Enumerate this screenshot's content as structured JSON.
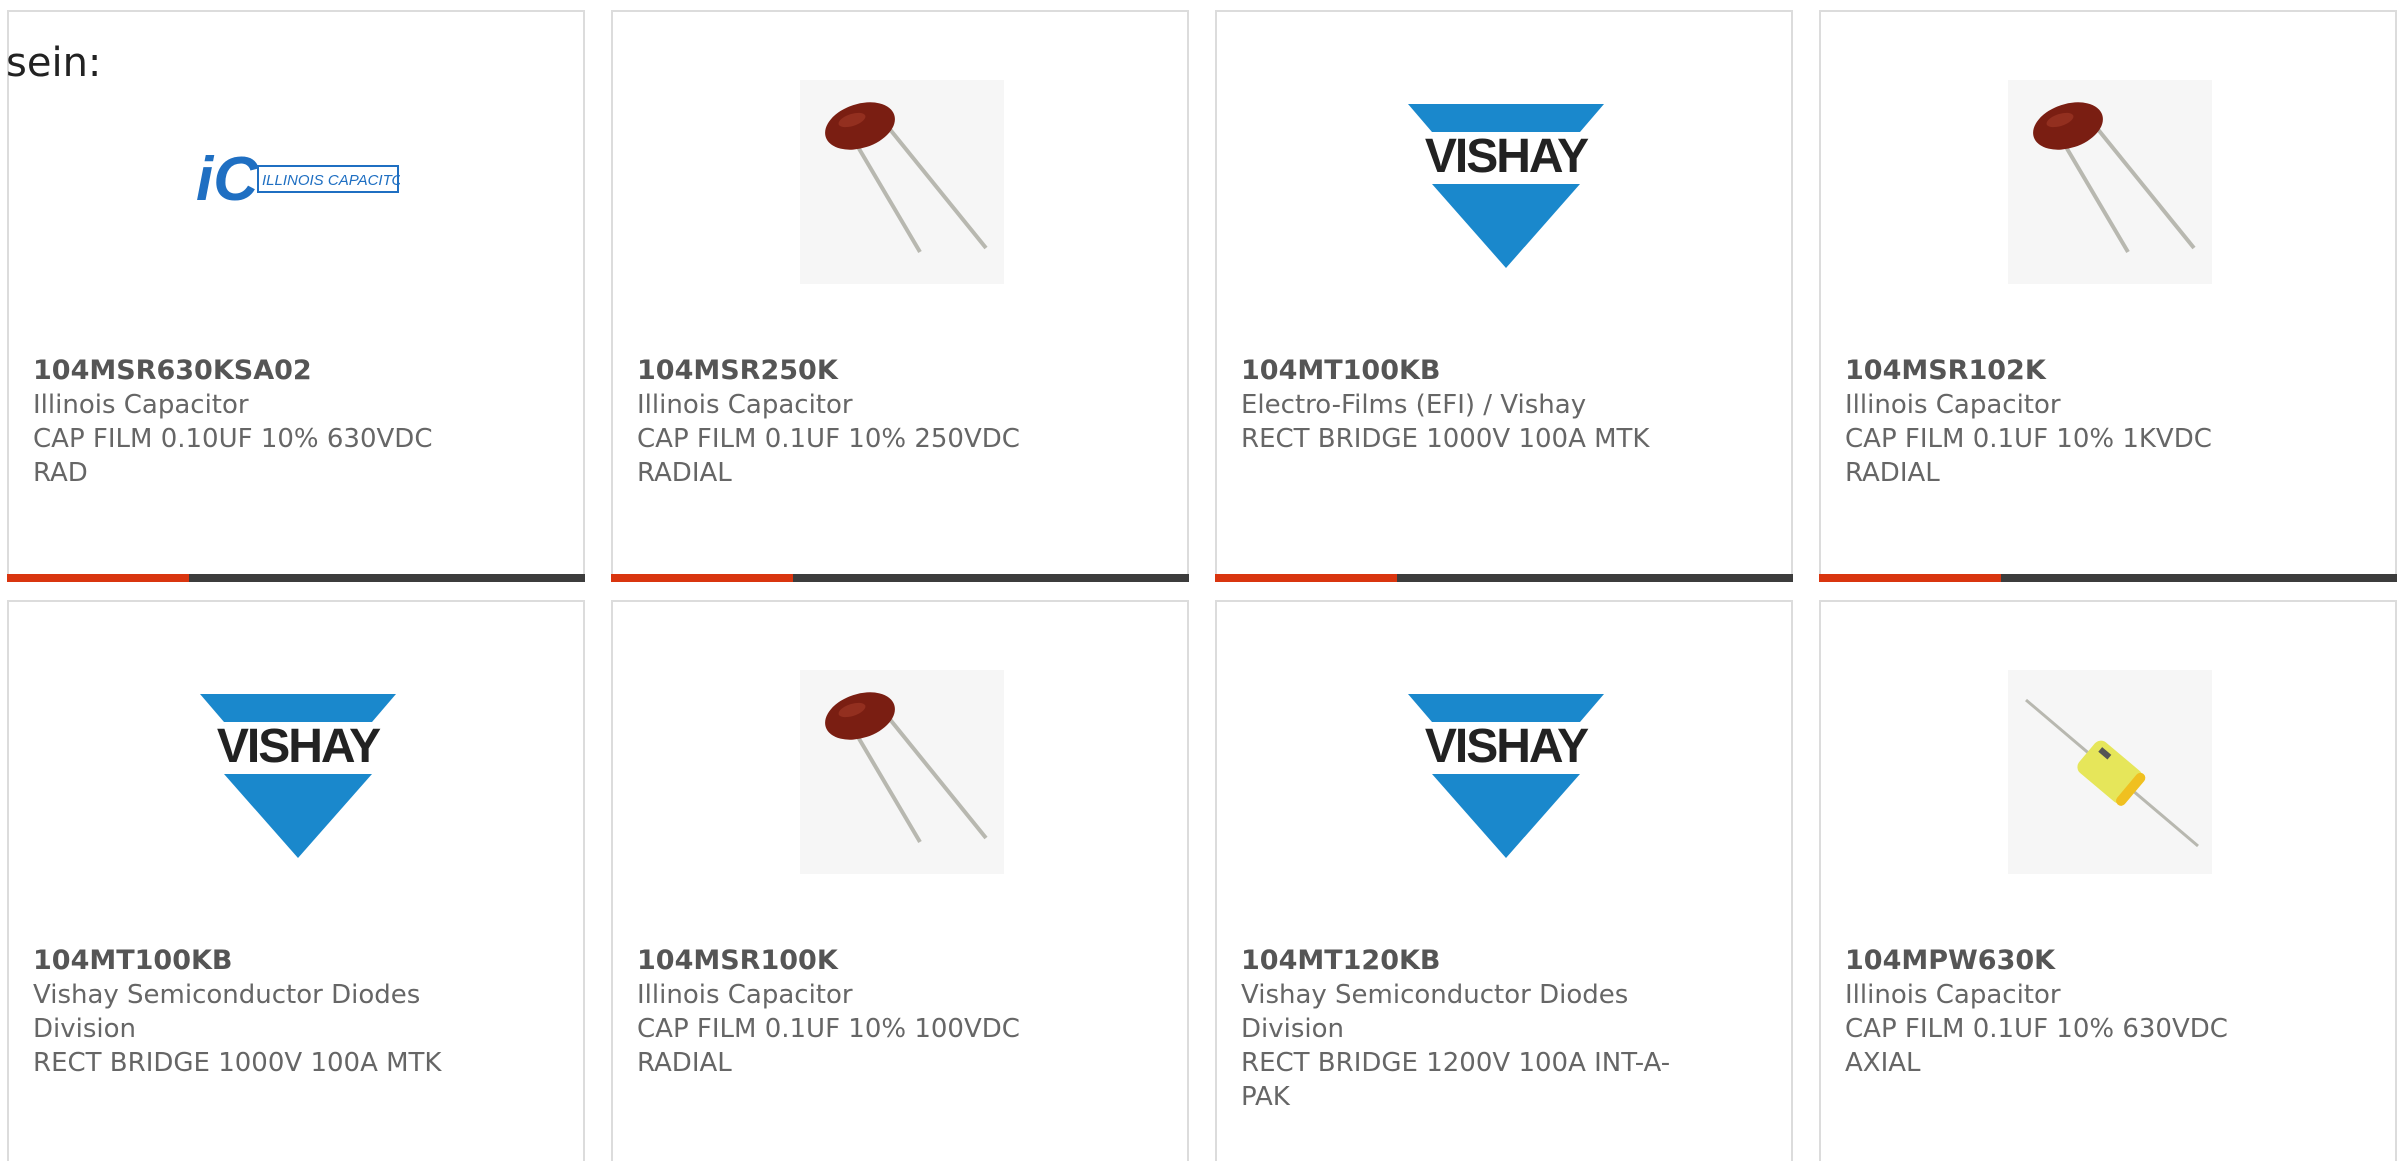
{
  "intro_text": "sein:",
  "colors": {
    "accent": "#d9350f",
    "bar": "#3c3c3c",
    "vishay_blue": "#1a88cc"
  },
  "products": [
    {
      "part_number": "104MSR630KSA02",
      "manufacturer": "Illinois Capacitor",
      "description": "CAP FILM 0.10UF 10% 630VDC RAD",
      "image": "illinois-capacitor-logo",
      "logo_text": "ILLINOIS CAPACITOR, INC."
    },
    {
      "part_number": "104MSR250K",
      "manufacturer": "Illinois Capacitor",
      "description": "CAP FILM 0.1UF 10% 250VDC RADIAL",
      "image": "radial-film-capacitor"
    },
    {
      "part_number": "104MT100KB",
      "manufacturer": "Electro-Films (EFI) / Vishay",
      "description": "RECT BRIDGE 1000V 100A MTK",
      "image": "vishay-logo",
      "logo_text": "VISHAY"
    },
    {
      "part_number": "104MSR102K",
      "manufacturer": "Illinois Capacitor",
      "description": "CAP FILM 0.1UF 10% 1KVDC RADIAL",
      "image": "radial-film-capacitor"
    },
    {
      "part_number": "104MT100KB",
      "manufacturer": "Vishay Semiconductor Diodes Division",
      "description": "RECT BRIDGE 1000V 100A MTK",
      "image": "vishay-logo",
      "logo_text": "VISHAY"
    },
    {
      "part_number": "104MSR100K",
      "manufacturer": "Illinois Capacitor",
      "description": "CAP FILM 0.1UF 10% 100VDC RADIAL",
      "image": "radial-film-capacitor"
    },
    {
      "part_number": "104MT120KB",
      "manufacturer": "Vishay Semiconductor Diodes Division",
      "description": "RECT BRIDGE 1200V 100A INT-A-PAK",
      "image": "vishay-logo",
      "logo_text": "VISHAY"
    },
    {
      "part_number": "104MPW630K",
      "manufacturer": "Illinois Capacitor",
      "description": "CAP FILM 0.1UF 10% 630VDC AXIAL",
      "image": "axial-film-capacitor"
    }
  ]
}
